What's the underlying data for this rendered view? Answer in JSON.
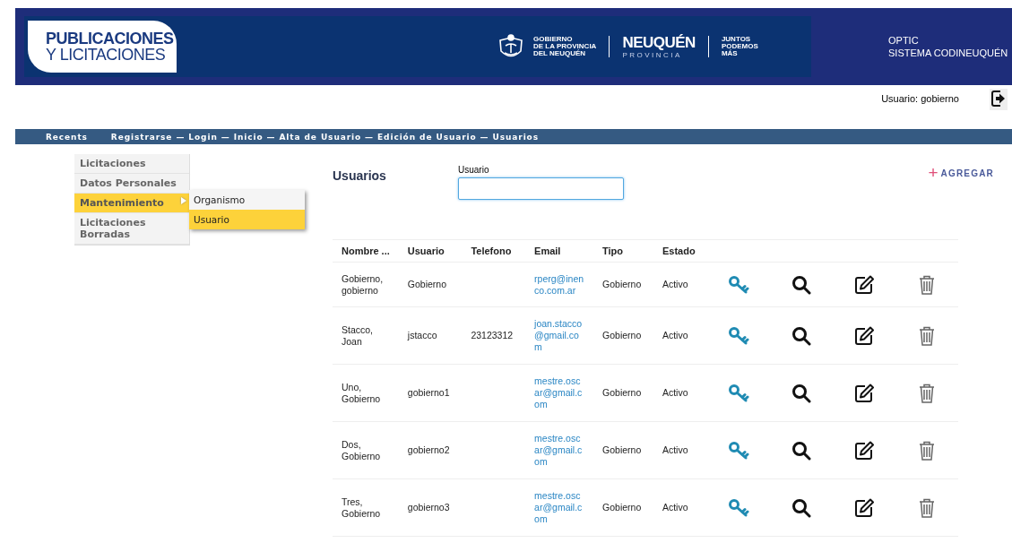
{
  "header": {
    "app_logo": [
      "PUBLICACIONES",
      "Y LICITACIONES"
    ],
    "gov_logo": {
      "lines": [
        "GOBIERNO",
        "DE LA PROVINCIA",
        "DEL NEUQUÉN"
      ],
      "name": "NEUQUÉN",
      "subtitle": "PROVINCIA",
      "slogan": [
        "JUNTOS",
        "PODEMOS",
        "MÁS"
      ]
    },
    "system": [
      "OPTIC",
      "SISTEMA CODINEUQUÉN"
    ]
  },
  "user_bar": {
    "user": "Usuario: gobierno"
  },
  "breadcrumb": {
    "label": "Recents",
    "path": "Registrarse — Login — Inicio — Alta de Usuario — Edición de Usuario — Usuarios"
  },
  "sidebar": {
    "items": [
      {
        "label": "Licitaciones",
        "selected": false
      },
      {
        "label": "Datos Personales",
        "selected": false
      },
      {
        "label": "Mantenimiento",
        "selected": true,
        "expanded": true,
        "children": [
          {
            "label": "Organismo",
            "selected": false
          },
          {
            "label": "Usuario",
            "selected": true
          }
        ]
      },
      {
        "label": "Licitaciones Borradas",
        "selected": false
      }
    ]
  },
  "page": {
    "title": "Usuarios",
    "filter_label": "Usuario",
    "add_icon": "+",
    "add_label": "AGREGAR"
  },
  "table": {
    "columns": [
      "Nombre ...",
      "Usuario",
      "Telefono",
      "Email",
      "Tipo",
      "Estado"
    ],
    "rows": [
      {
        "nombre": "Gobierno, gobierno",
        "usuario": "Gobierno",
        "telefono": "",
        "email": "rperg@inenco.com.ar",
        "tipo": "Gobierno",
        "estado": "Activo"
      },
      {
        "nombre": "Stacco, Joan",
        "usuario": "jstacco",
        "telefono": "23123312",
        "email": "joan.stacco@gmail.com",
        "tipo": "Gobierno",
        "estado": "Activo"
      },
      {
        "nombre": "Uno, Gobierno",
        "usuario": "gobierno1",
        "telefono": "",
        "email": "mestre.oscar@gmail.com",
        "tipo": "Gobierno",
        "estado": "Activo"
      },
      {
        "nombre": "Dos, Gobierno",
        "usuario": "gobierno2",
        "telefono": "",
        "email": "mestre.oscar@gmail.com",
        "tipo": "Gobierno",
        "estado": "Activo"
      },
      {
        "nombre": "Tres, Gobierno",
        "usuario": "gobierno3",
        "telefono": "",
        "email": "mestre.oscar@gmail.com",
        "tipo": "Gobierno",
        "estado": "Activo"
      }
    ]
  }
}
